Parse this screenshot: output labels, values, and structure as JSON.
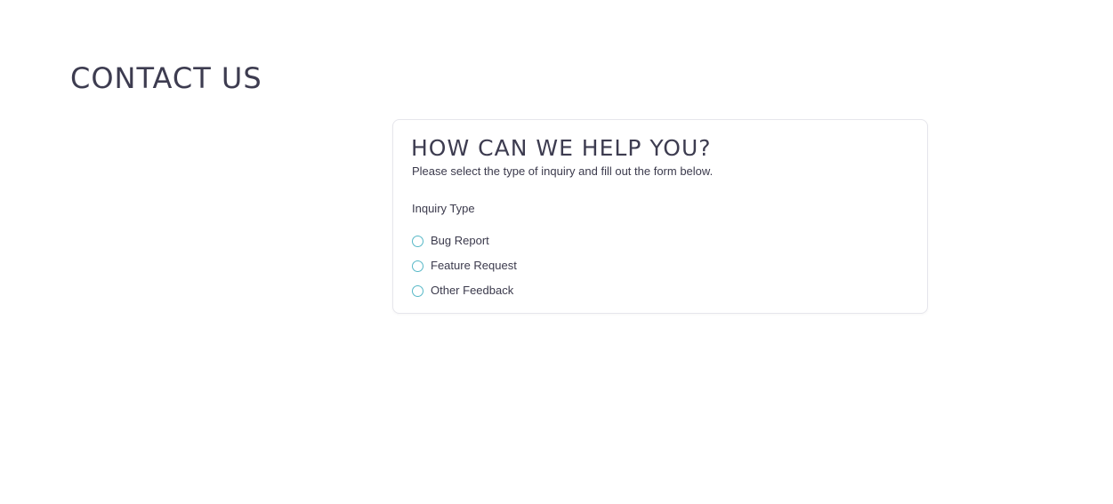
{
  "page": {
    "title": "CONTACT US"
  },
  "card": {
    "title": "HOW CAN WE HELP YOU?",
    "subtitle": "Please select the type of inquiry and fill out the form below."
  },
  "inquiry": {
    "label": "Inquiry Type",
    "options": [
      {
        "label": "Bug Report",
        "selected": false
      },
      {
        "label": "Feature Request",
        "selected": false
      },
      {
        "label": "Other Feedback",
        "selected": false
      }
    ]
  },
  "colors": {
    "heading": "#3d3c50",
    "text": "#3b3a4c",
    "radio_border": "#57b8c7",
    "card_border": "#e6e6ec"
  }
}
